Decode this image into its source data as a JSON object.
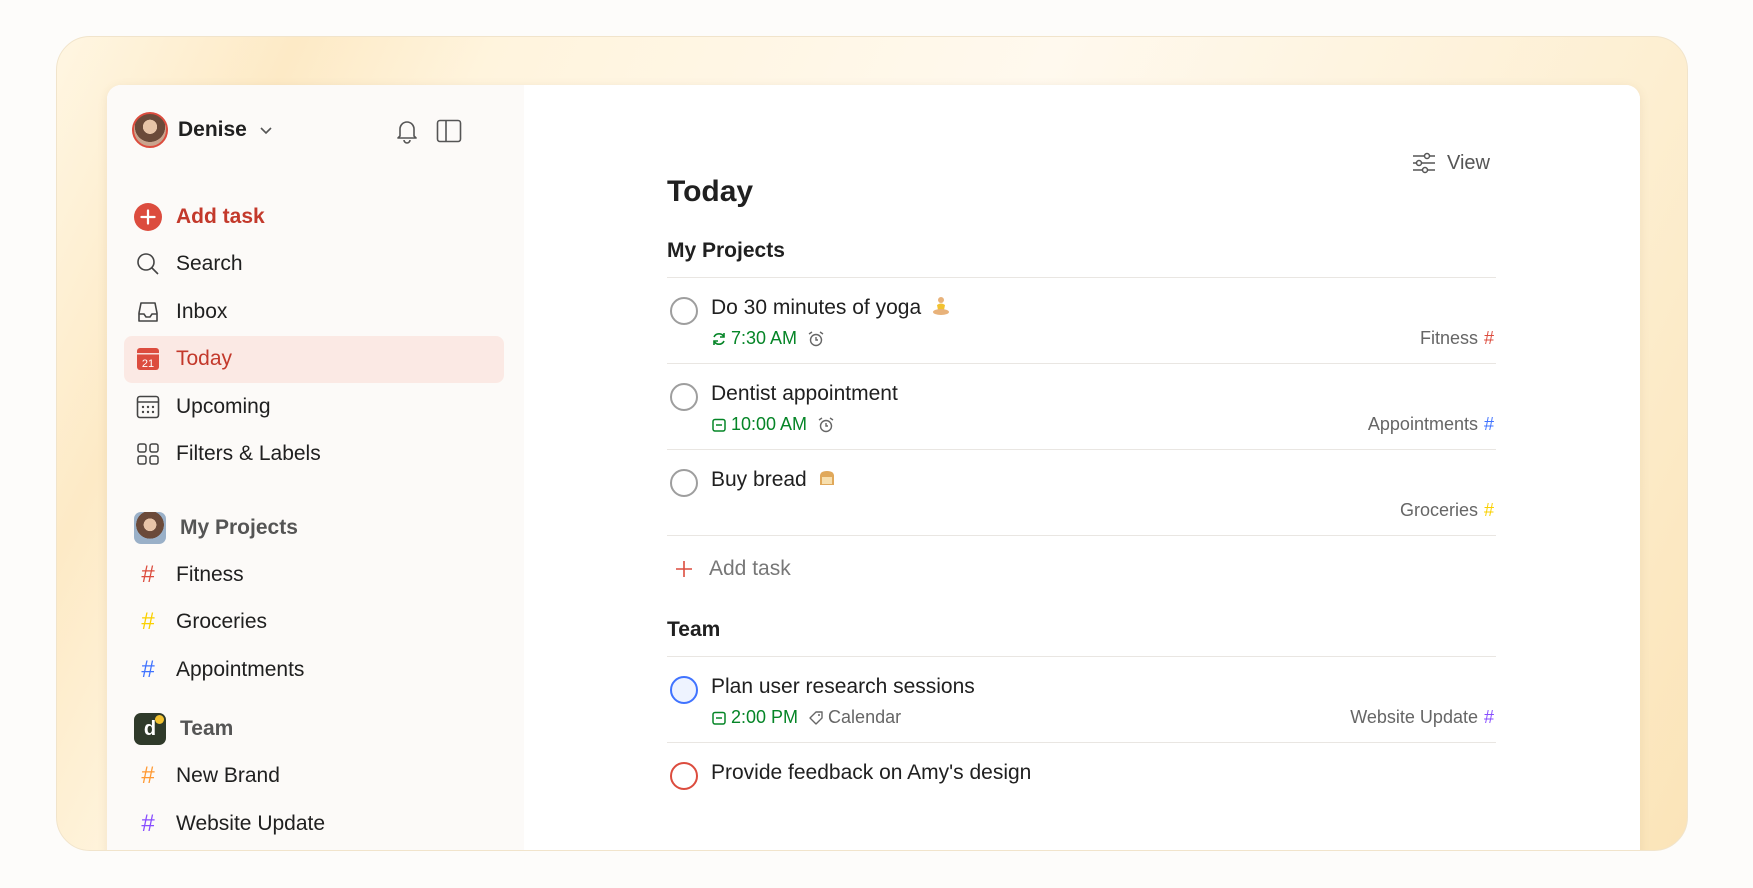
{
  "user": {
    "name": "Denise"
  },
  "nav": {
    "add_task": "Add task",
    "search": "Search",
    "inbox": "Inbox",
    "today": "Today",
    "today_day": "21",
    "upcoming": "Upcoming",
    "filters": "Filters & Labels"
  },
  "projects": {
    "title": "My Projects",
    "items": [
      {
        "name": "Fitness",
        "color": "#dc4c3e"
      },
      {
        "name": "Groceries",
        "color": "#fad000"
      },
      {
        "name": "Appointments",
        "color": "#4073ff"
      }
    ]
  },
  "team": {
    "title": "Team",
    "avatar_letter": "d",
    "items": [
      {
        "name": "New Brand",
        "color": "#ff9933"
      },
      {
        "name": "Website Update",
        "color": "#884dff"
      }
    ]
  },
  "main": {
    "view_label": "View",
    "title": "Today",
    "sections": [
      {
        "title": "My Projects",
        "tasks": [
          {
            "title": "Do 30 minutes of yoga",
            "time": "7:30 AM",
            "project": "Fitness",
            "project_color": "#dc4c3e",
            "emoji": "person-in-lotus-position-icon"
          },
          {
            "title": "Dentist appointment",
            "time": "10:00 AM",
            "project": "Appointments",
            "project_color": "#4073ff"
          },
          {
            "title": "Buy bread",
            "project": "Groceries",
            "project_color": "#fad000",
            "emoji": "bread-icon"
          }
        ],
        "add_task": "Add task"
      },
      {
        "title": "Team",
        "tasks": [
          {
            "title": "Plan user research sessions",
            "time": "2:00 PM",
            "label": "Calendar",
            "project": "Website Update",
            "project_color": "#884dff"
          },
          {
            "title": "Provide feedback on Amy's design"
          }
        ]
      }
    ]
  },
  "colors": {
    "accent": "#dc4c3e",
    "due_today": "#058527",
    "active_bg": "#fbe9e4"
  }
}
